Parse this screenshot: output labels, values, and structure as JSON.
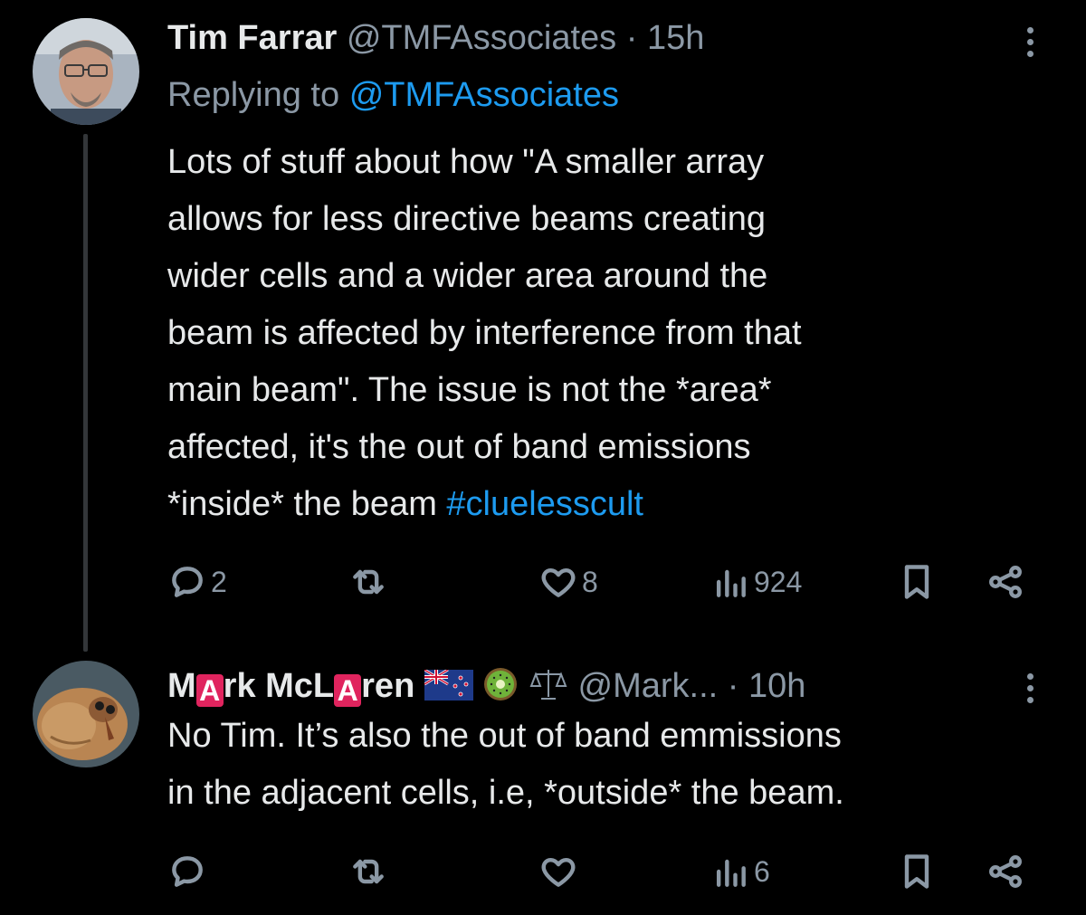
{
  "tweets": [
    {
      "author_name": "Tim Farrar",
      "handle": "@TMFAssociates",
      "separator": "·",
      "time": "15h",
      "replying_prefix": "Replying to",
      "replying_handle": "@TMFAssociates",
      "body_lines": [
        "Lots of stuff about how \"A smaller array",
        "allows for less directive beams creating",
        "wider cells and a wider area around the",
        "beam is affected by interference from that",
        "main beam\". The issue is not the *area*",
        "affected, it's the out of band emissions",
        "*inside* the beam "
      ],
      "hashtag": "#cluelesscult",
      "replies": "2",
      "reposts": "",
      "likes": "8",
      "views": "924"
    },
    {
      "author_name_parts": [
        "M",
        "A",
        "rk McL",
        "A",
        "ren"
      ],
      "handle": "@Mark...",
      "separator": "·",
      "time": "10h",
      "body_lines": [
        "No Tim. It’s also the out of band emmissions",
        "in the adjacent cells, i.e, *outside* the beam."
      ],
      "replies": "",
      "reposts": "",
      "likes": "",
      "views": "6"
    }
  ],
  "icons": {
    "reply": "reply-icon",
    "repost": "repost-icon",
    "like": "heart-icon",
    "views": "views-icon",
    "bookmark": "bookmark-icon",
    "share": "share-icon",
    "more": "more-icon"
  },
  "colors": {
    "background": "#000000",
    "text": "#e7e9ea",
    "muted": "#8b98a5",
    "link": "#1d9bf0",
    "badge": "#e0245e"
  }
}
